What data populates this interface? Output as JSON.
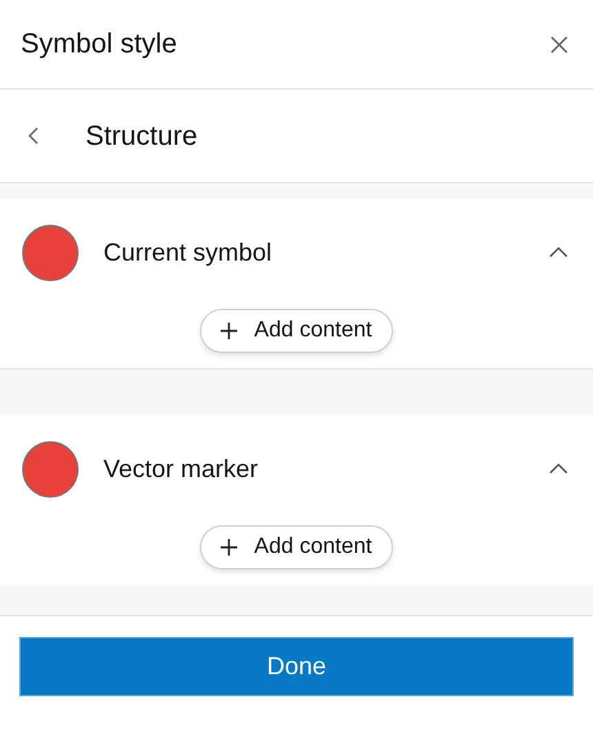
{
  "panel": {
    "title": "Symbol style"
  },
  "subheader": {
    "title": "Structure"
  },
  "sections": [
    {
      "label": "Current symbol",
      "color": "#e8403b",
      "expanded": true,
      "action": "Add content"
    },
    {
      "label": "Vector marker",
      "color": "#e8403b",
      "expanded": true,
      "action": "Add content"
    }
  ],
  "footer": {
    "button": "Done"
  }
}
